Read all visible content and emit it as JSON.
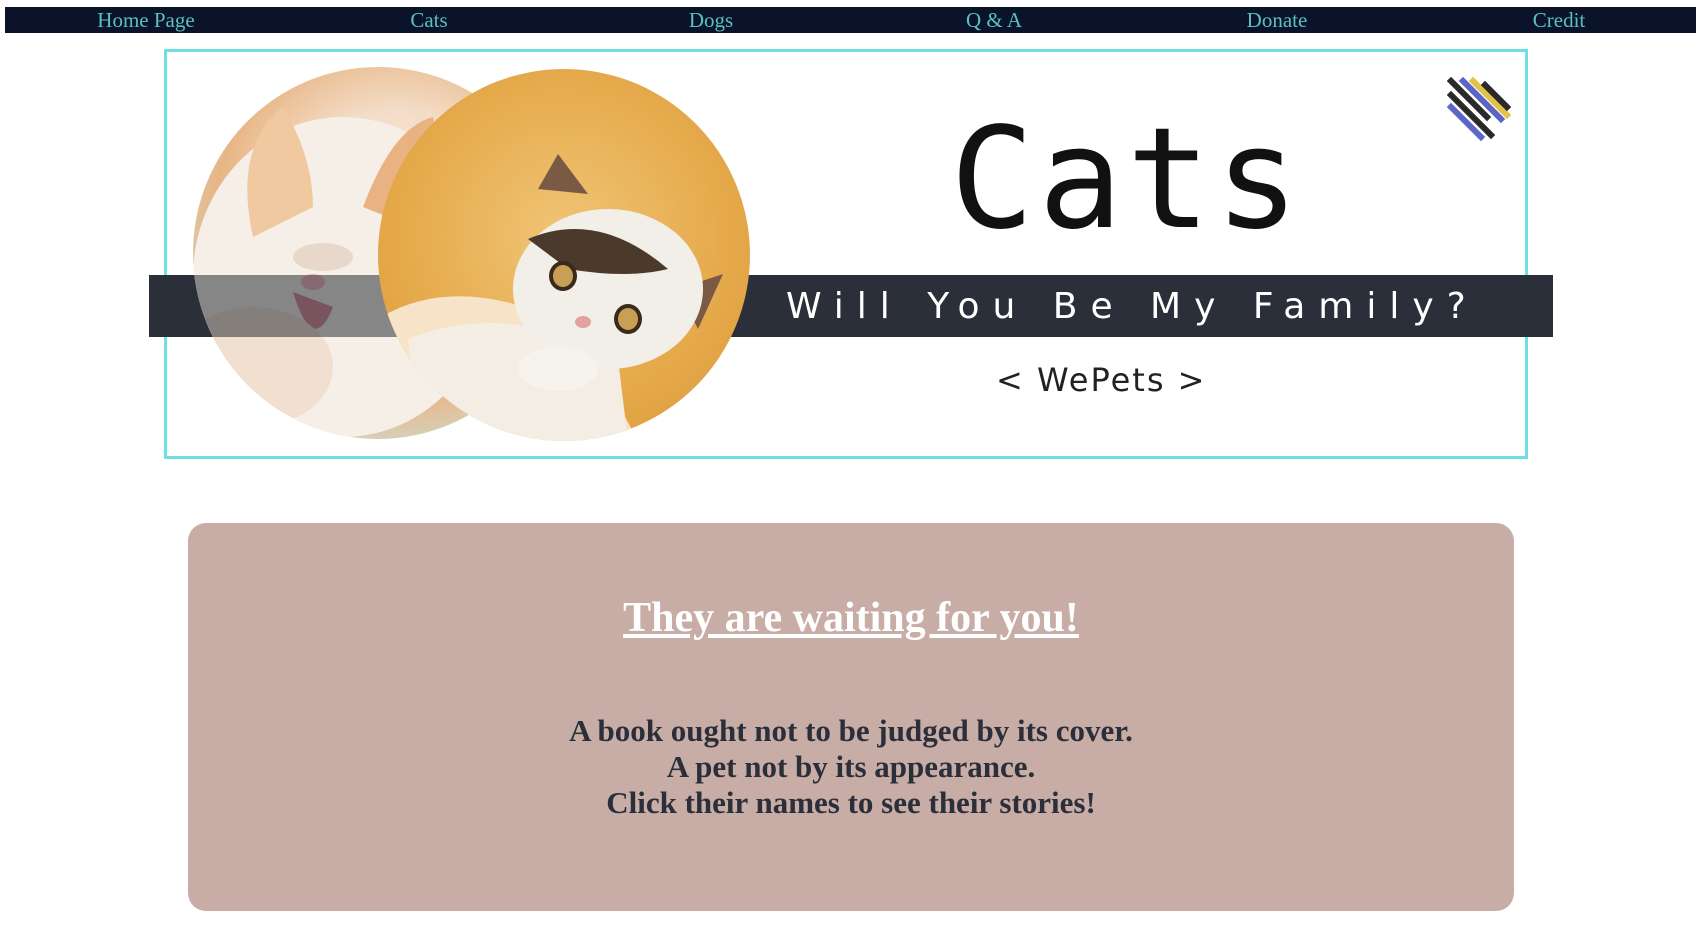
{
  "nav": {
    "items": [
      {
        "label": "Home Page"
      },
      {
        "label": "Cats"
      },
      {
        "label": "Dogs"
      },
      {
        "label": "Q & A"
      },
      {
        "label": "Donate"
      },
      {
        "label": "Credit"
      }
    ]
  },
  "banner": {
    "title": "Cats",
    "tagline": "Will You Be My Family?",
    "brand": "< WePets >",
    "menu_icon": "hamburger-menu-icon"
  },
  "card": {
    "heading": "They are waiting for you!",
    "lines": [
      "A book ought not to be judged by its cover.",
      "A pet not by its appearance.",
      "Click their names to see their stories!"
    ]
  },
  "colors": {
    "nav_background": "#0b132b",
    "nav_text": "#5bc0be",
    "banner_border": "#6fdfe3",
    "banner_stripe": "#2b2f39",
    "card_background": "#c8ada7",
    "card_heading": "#ffffff",
    "card_text": "#2b2f3a"
  }
}
